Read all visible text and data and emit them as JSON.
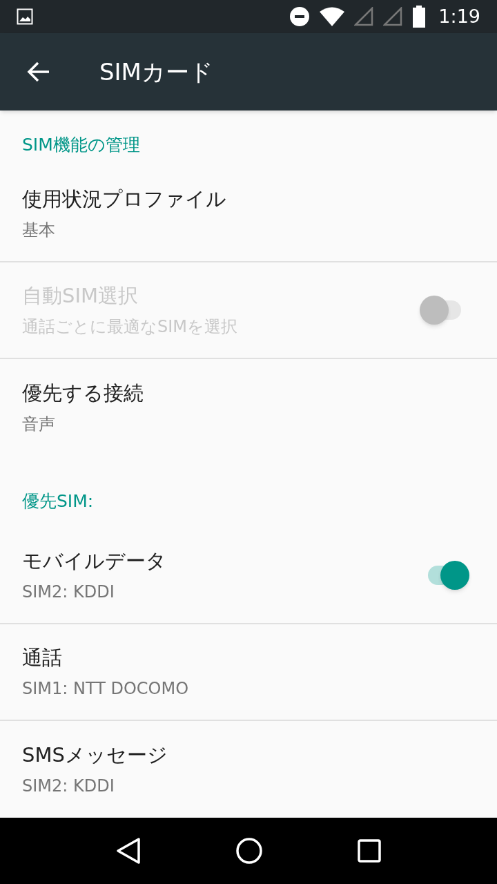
{
  "status_bar": {
    "time": "1:19"
  },
  "app_bar": {
    "title": "SIMカード"
  },
  "sections": [
    {
      "header": "SIM機能の管理",
      "items": [
        {
          "kind": "plain",
          "title": "使用状況プロファイル",
          "subtitle": "基本",
          "disabled": false
        },
        {
          "kind": "toggle",
          "title": "自動SIM選択",
          "subtitle": "通話ごとに最適なSIMを選択",
          "disabled": true,
          "on": false
        },
        {
          "kind": "plain",
          "title": "優先する接続",
          "subtitle": "音声",
          "disabled": false
        }
      ]
    },
    {
      "header": "優先SIM:",
      "items": [
        {
          "kind": "toggle",
          "title": "モバイルデータ",
          "subtitle": "SIM2: KDDI",
          "disabled": false,
          "on": true
        },
        {
          "kind": "plain",
          "title": "通話",
          "subtitle": "SIM1: NTT DOCOMO",
          "disabled": false
        },
        {
          "kind": "plain",
          "title": "SMSメッセージ",
          "subtitle": "SIM2: KDDI",
          "disabled": false
        }
      ]
    }
  ]
}
